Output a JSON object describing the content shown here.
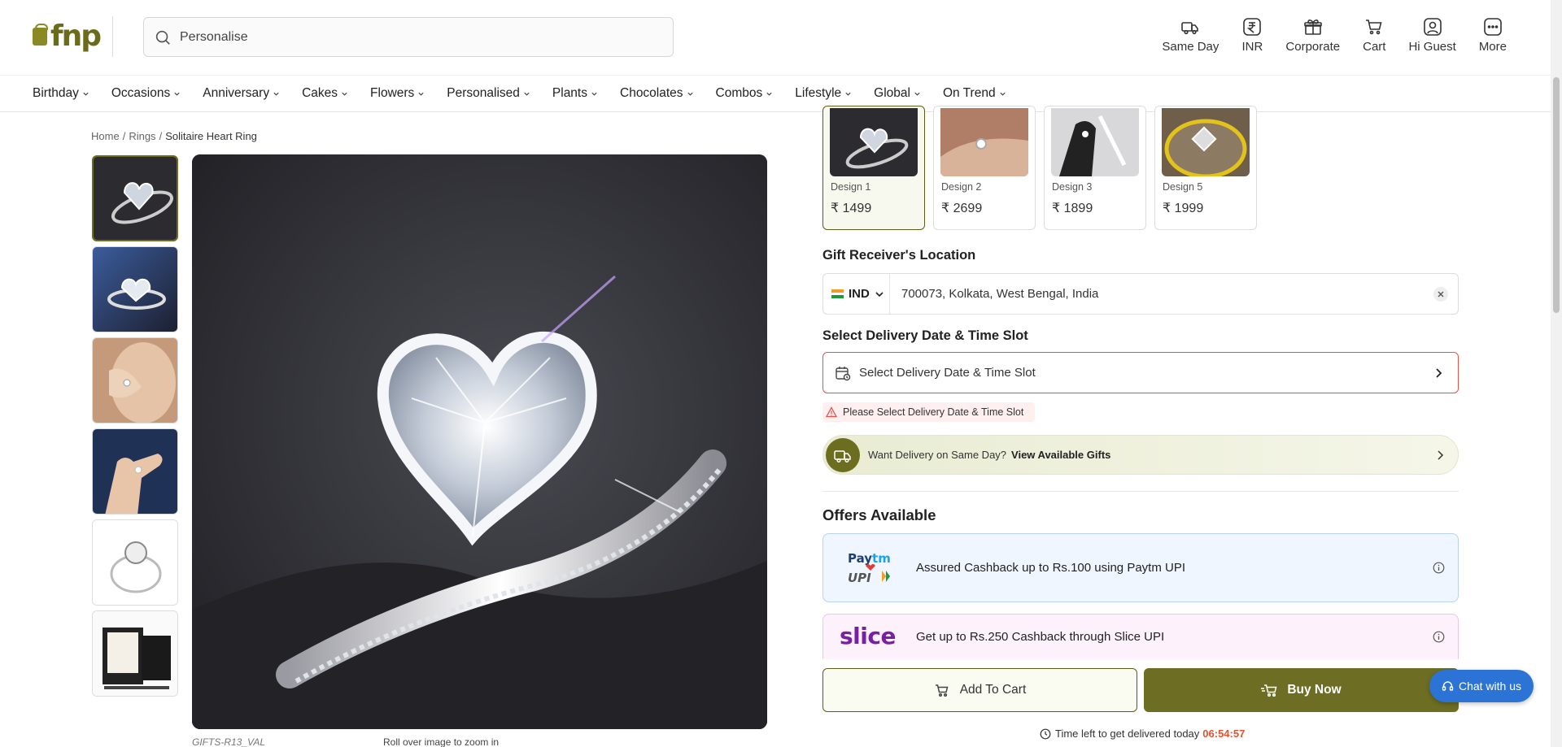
{
  "header": {
    "logo_text": "fnp",
    "search_placeholder": "Personalise",
    "actions": [
      {
        "label": "Same Day",
        "icon": "truck-icon"
      },
      {
        "label": "INR",
        "icon": "rupee-icon"
      },
      {
        "label": "Corporate",
        "icon": "gift-icon"
      },
      {
        "label": "Cart",
        "icon": "cart-icon"
      },
      {
        "label": "Hi Guest",
        "icon": "user-icon"
      },
      {
        "label": "More",
        "icon": "more-icon"
      }
    ]
  },
  "nav": {
    "items": [
      "Birthday",
      "Occasions",
      "Anniversary",
      "Cakes",
      "Flowers",
      "Personalised",
      "Plants",
      "Chocolates",
      "Combos",
      "Lifestyle",
      "Global",
      "On Trend"
    ]
  },
  "breadcrumb": {
    "home": "Home",
    "category": "Rings",
    "current": "Solitaire Heart Ring"
  },
  "product": {
    "sku": "GIFTS-R13_VAL",
    "zoom_hint": "Roll over image to zoom in"
  },
  "designs": [
    {
      "name": "Design 1",
      "price": "₹ 1499",
      "selected": true
    },
    {
      "name": "Design 2",
      "price": "₹ 2699",
      "selected": false
    },
    {
      "name": "Design 3",
      "price": "₹ 1899",
      "selected": false
    },
    {
      "name": "Design 5",
      "price": "₹ 1999",
      "selected": false
    }
  ],
  "location": {
    "title": "Gift Receiver's Location",
    "country": "IND",
    "value": "700073, Kolkata, West Bengal, India"
  },
  "delivery": {
    "title": "Select Delivery Date & Time Slot",
    "placeholder": "Select Delivery Date & Time Slot",
    "error": "Please Select Delivery Date & Time Slot"
  },
  "sameday": {
    "text": "Want Delivery on Same Day?",
    "link": "View Available Gifts"
  },
  "offers": {
    "title": "Offers Available",
    "items": [
      {
        "brand": "Paytm UPI",
        "text": "Assured Cashback up to Rs.100 using Paytm UPI"
      },
      {
        "brand": "slice",
        "text": "Get up to Rs.250 Cashback through Slice UPI"
      }
    ]
  },
  "actions": {
    "add_to_cart": "Add To Cart",
    "buy_now": "Buy Now"
  },
  "timer": {
    "label": "Time left to get delivered today",
    "value": "06:54:57"
  },
  "chat": {
    "label": "Chat with us"
  },
  "colors": {
    "brand": "#6d6d24",
    "error": "#e3534b",
    "chat": "#2b74d6",
    "timer": "#e4522f"
  }
}
